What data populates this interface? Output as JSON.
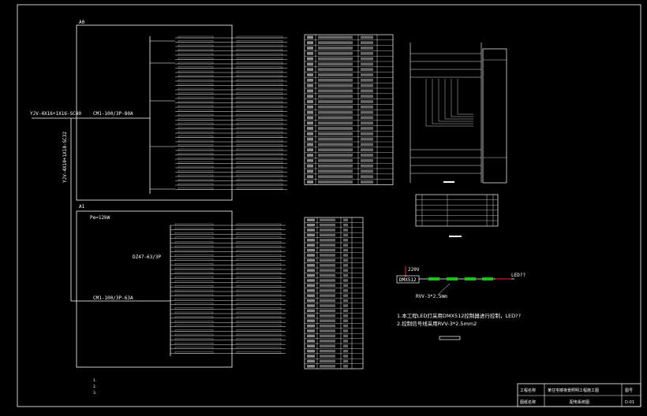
{
  "panels": {
    "a0_label": "A0",
    "a1_label": "A1",
    "a0_incoming": "YJV-4X16+1X16-SC40",
    "a1_incoming": "YJV-4X10+1X10-SC32",
    "a0_main": "CM1-100/3P-80A",
    "a1_main": "CM1-100/3P-63A",
    "a1_header": "Pe=12kW",
    "a1_breaker": "DZ47-63/3P",
    "a1_feed": "YJV-5X6-SC32"
  },
  "wiring_note": "220V-LED",
  "led_line": {
    "voltage": "220V",
    "box": "DMX512",
    "end_label": "LED??",
    "cable": "RVV-3*2.5mm"
  },
  "notes": {
    "line1": "1.本工程LED灯采用DMX512控制器进行控制，LED??",
    "line2": "2.控制信号线采用RVV-3*2.5mm2"
  },
  "title_block": {
    "cell1": "工程名称",
    "cell2": "某住宅楼夜景照明工程施工图",
    "cell3": "图号",
    "cell4": "图纸名称",
    "cell5": "配电系统图",
    "cell6": "D-01"
  },
  "colors": {
    "line": "#ffffff",
    "accent": "#ff2020",
    "green": "#19c419",
    "frame": "#d0d0d0"
  }
}
